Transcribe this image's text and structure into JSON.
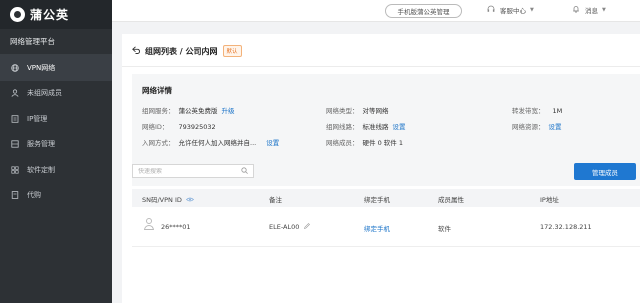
{
  "app": {
    "logo_text": "蒲公英"
  },
  "sidebar": {
    "title": "网络管理平台",
    "items": [
      {
        "label": "VPN网络",
        "icon": "globe-icon",
        "active": true
      },
      {
        "label": "未组网成员",
        "icon": "user-icon"
      },
      {
        "label": "IP管理",
        "icon": "ip-icon"
      },
      {
        "label": "服务管理",
        "icon": "server-icon"
      },
      {
        "label": "软件定制",
        "icon": "grid-icon"
      },
      {
        "label": "代购",
        "icon": "document-icon"
      }
    ]
  },
  "header": {
    "pill_label": "手机版蒲公英管理",
    "help_label": "客服中心",
    "message_label": "消息"
  },
  "breadcrumb": {
    "text": "组网列表 / 公司内网",
    "badge": "默认"
  },
  "details": {
    "title": "网络详情",
    "service_label": "组网服务：",
    "service_value": "蒲公英免费版",
    "service_link": "升级",
    "type_label": "网络类型：",
    "type_value": "对等网络",
    "bandwidth_label": "转发带宽：",
    "bandwidth_value": "1M",
    "id_label": "网络ID：",
    "id_value": "793925032",
    "line_label": "组网线路：",
    "line_value": "标准线路",
    "line_link": "设置",
    "resource_label": "网络资源：",
    "resource_link": "设置",
    "join_label": "入网方式：",
    "join_value": "允许任何人加入网络并自...",
    "join_link": "设置",
    "members_label": "网络成员：",
    "members_value": "硬件 0   软件 1"
  },
  "search": {
    "placeholder": "快速搜索"
  },
  "manage_button": "管理成员",
  "table": {
    "headers": [
      "SN码/VPN ID",
      "备注",
      "绑定手机",
      "成员属性",
      "IP地址"
    ],
    "rows": [
      {
        "id": "26****01",
        "note": "ELE-AL00",
        "phone": "绑定手机",
        "attr": "软件",
        "ip": "172.32.128.211"
      }
    ]
  },
  "colors": {
    "accent": "#1f78d1",
    "sidebar_bg": "#2d3135",
    "badge": "#e6772a"
  }
}
